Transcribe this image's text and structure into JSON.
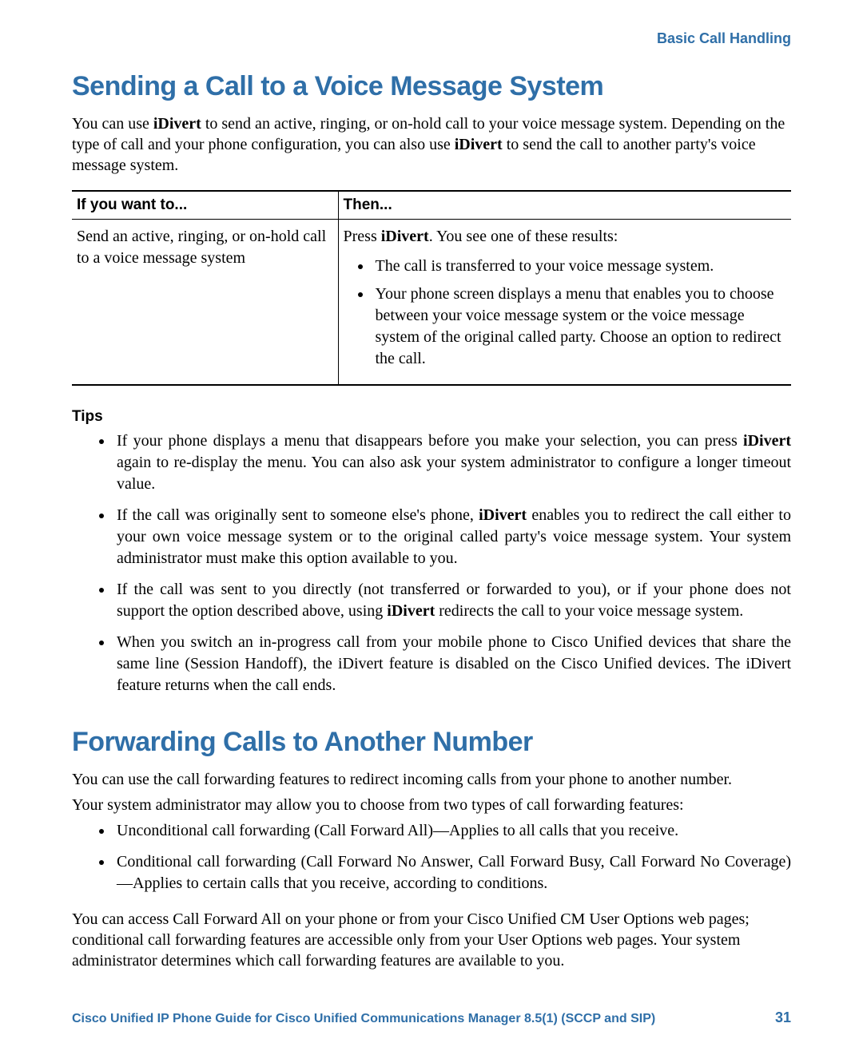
{
  "header": {
    "section": "Basic Call Handling"
  },
  "section1": {
    "title": "Sending a Call to a Voice Message System",
    "intro_pre": "You can use ",
    "intro_key1": "iDivert",
    "intro_mid": " to send an active, ringing, or on-hold call to your voice message system. Depending on the type of call and your phone configuration, you can also use ",
    "intro_key2": "iDivert",
    "intro_post": " to send the call to another party's voice message system.",
    "table": {
      "headers": [
        "If you want to...",
        "Then..."
      ],
      "col1": "Send an active, ringing, or on-hold call to a voice message system",
      "col2_pre": "Press ",
      "col2_key": "iDivert",
      "col2_post": ". You see one of these results:",
      "bullets": [
        "The call is transferred to your voice message system.",
        "Your phone screen displays a menu that enables you to choose between your voice message system or the voice message system of the original called party. Choose an option to redirect the call."
      ]
    },
    "tips_heading": "Tips",
    "tips": {
      "t1_pre": "If your phone displays a menu that disappears before you make your selection, you can press ",
      "t1_key": "iDivert",
      "t1_post": " again to re-display the menu. You can also ask your system administrator to configure a longer timeout value.",
      "t2_pre": "If the call was originally sent to someone else's phone, ",
      "t2_key": "iDivert",
      "t2_post": " enables you to redirect the call either to your own voice message system or to the original called party's voice message system. Your system administrator must make this option available to you.",
      "t3_pre": "If the call was sent to you directly (not transferred or forwarded to you), or if your phone does not support the option described above, using ",
      "t3_key": "iDivert",
      "t3_post": " redirects the call to your voice message system.",
      "t4": "When you switch an in-progress call from your mobile phone to Cisco Unified devices that share the same line (Session Handoff), the iDivert feature is disabled on the Cisco Unified devices. The iDivert feature returns when the call ends."
    }
  },
  "section2": {
    "title": "Forwarding Calls to Another Number",
    "p1": "You can use the call forwarding features to redirect incoming calls from your phone to another number.",
    "p2": "Your system administrator may allow you to choose from two types of call forwarding features:",
    "bullets": [
      "Unconditional call forwarding (Call Forward All)—Applies to all calls that you receive.",
      "Conditional call forwarding (Call Forward No Answer, Call Forward Busy, Call Forward No Coverage)—Applies to certain calls that you receive, according to conditions."
    ],
    "p3": "You can access Call Forward All on your phone or from your Cisco Unified CM User Options web pages; conditional call forwarding features are accessible only from your User Options web pages. Your system administrator determines which call forwarding features are available to you."
  },
  "footer": {
    "title": "Cisco Unified IP Phone Guide for Cisco Unified Communications Manager 8.5(1) (SCCP and SIP)",
    "page": "31"
  }
}
